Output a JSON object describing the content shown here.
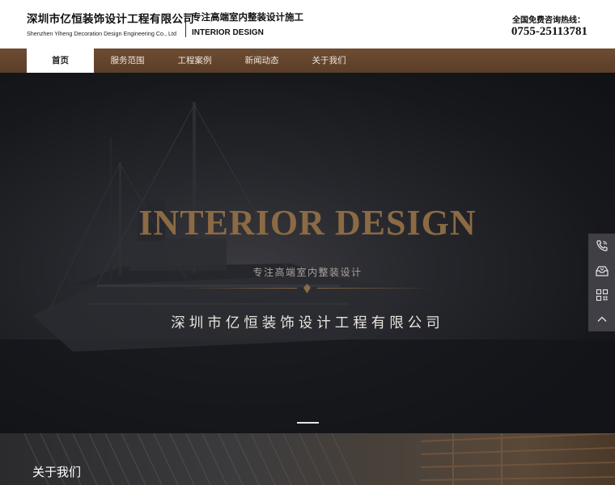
{
  "header": {
    "brand_cn": "深圳市亿恒装饰设计工程有限公司",
    "brand_en": "Shenzhen Yiheng Decoration Design Engineering Co., Ltd",
    "slogan_cn": "专注高端室内整装设计施工",
    "slogan_en": "INTERIOR DESIGN",
    "hotline_label": "全国免费咨询热线：",
    "hotline_number": "0755-25113781"
  },
  "nav": {
    "items": [
      {
        "label": "首页",
        "active": true
      },
      {
        "label": "服务范围"
      },
      {
        "label": "工程案例"
      },
      {
        "label": "新闻动态"
      },
      {
        "label": "关于我们"
      }
    ]
  },
  "hero": {
    "title": "INTERIOR DESIGN",
    "subtitle": "专注高端室内整装设计",
    "company": "深圳市亿恒装饰设计工程有限公司",
    "slide_count": 1,
    "active_slide": 1
  },
  "side_tools": {
    "items": [
      {
        "icon": "phone-icon"
      },
      {
        "icon": "inbox-icon"
      },
      {
        "icon": "qr-code-icon"
      },
      {
        "icon": "chevron-up-icon"
      }
    ]
  },
  "about": {
    "label": "关于我们"
  },
  "colors": {
    "nav_bg": "#5f412b",
    "accent_gold": "#8b6a44",
    "hero_bg": "#1c1d21"
  }
}
